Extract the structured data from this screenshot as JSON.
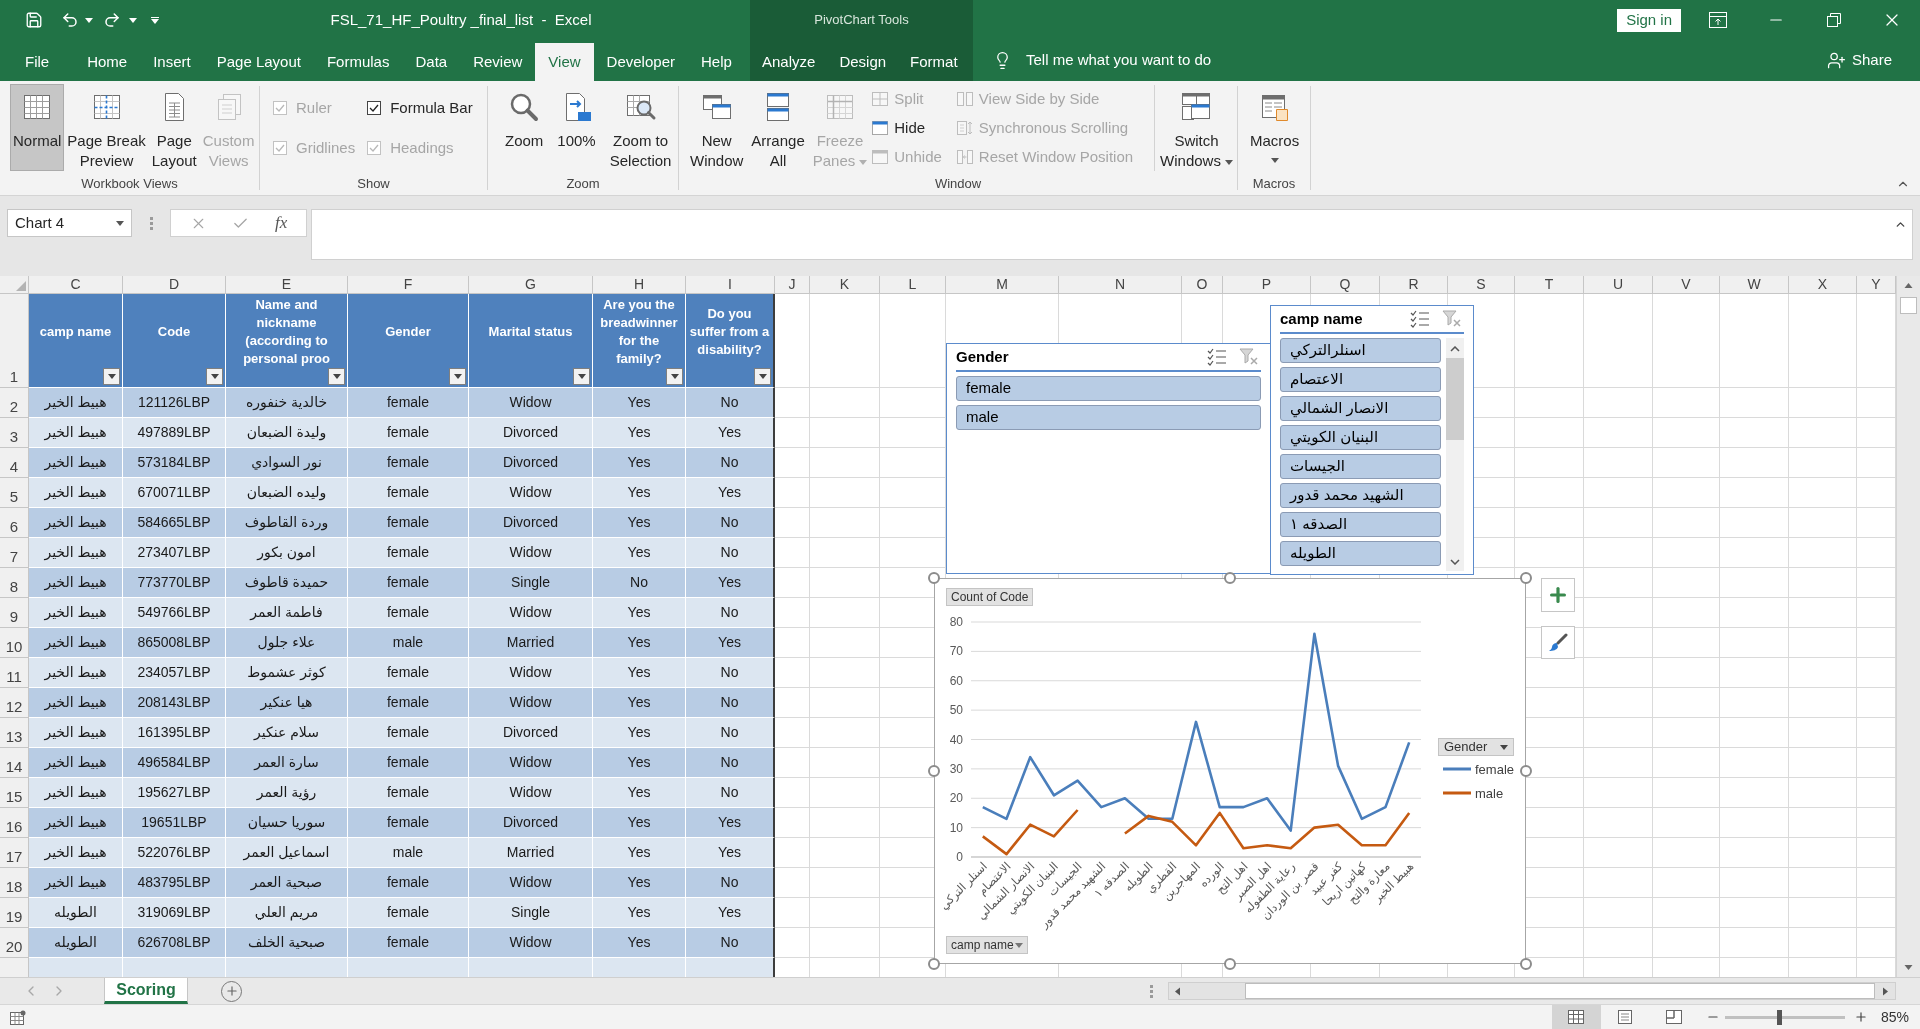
{
  "title_bar": {
    "title": "FSL_71_HF_Poultry _final_list  -  Excel",
    "context_label": "PivotChart Tools",
    "sign_in": "Sign in"
  },
  "ribbon_tabs": [
    {
      "label": "File",
      "selected": false
    },
    {
      "label": "Home",
      "selected": false
    },
    {
      "label": "Insert",
      "selected": false
    },
    {
      "label": "Page Layout",
      "selected": false
    },
    {
      "label": "Formulas",
      "selected": false
    },
    {
      "label": "Data",
      "selected": false
    },
    {
      "label": "Review",
      "selected": false
    },
    {
      "label": "View",
      "selected": true
    },
    {
      "label": "Developer",
      "selected": false
    },
    {
      "label": "Help",
      "selected": false
    }
  ],
  "context_tabs": [
    {
      "label": "Analyze",
      "selected": false
    },
    {
      "label": "Design",
      "selected": false
    },
    {
      "label": "Format",
      "selected": false
    }
  ],
  "tell_me": {
    "placeholder": "Tell me what you want to do"
  },
  "share": "Share",
  "ribbon_groups": [
    {
      "label": "Workbook Views",
      "columns": [
        {
          "kind": "large",
          "label": "Normal",
          "selected": true,
          "disabled": false
        },
        {
          "kind": "large",
          "label": "Page Break\nPreview",
          "selected": false,
          "disabled": false
        },
        {
          "kind": "large",
          "label": "Page\nLayout",
          "selected": false,
          "disabled": false
        },
        {
          "kind": "large",
          "label": "Custom\nViews",
          "selected": false,
          "disabled": true
        }
      ]
    },
    {
      "label": "Show",
      "columns": [
        {
          "kind": "stack",
          "items": [
            {
              "kind": "check",
              "label": "Ruler",
              "checked": true,
              "disabled": true
            },
            {
              "kind": "check",
              "label": "Gridlines",
              "checked": true,
              "disabled": true
            }
          ]
        },
        {
          "kind": "stack",
          "items": [
            {
              "kind": "check",
              "label": "Formula Bar",
              "checked": true,
              "disabled": false
            },
            {
              "kind": "check",
              "label": "Headings",
              "checked": true,
              "disabled": true
            }
          ]
        }
      ]
    },
    {
      "label": "Zoom",
      "columns": [
        {
          "kind": "large",
          "label": "Zoom",
          "disabled": false
        },
        {
          "kind": "large",
          "label": "100%",
          "disabled": false
        },
        {
          "kind": "large",
          "label": "Zoom to\nSelection",
          "disabled": false
        }
      ]
    },
    {
      "label": "Window",
      "columns": [
        {
          "kind": "large",
          "label": "New\nWindow",
          "disabled": false
        },
        {
          "kind": "large",
          "label": "Arrange\nAll",
          "disabled": false
        },
        {
          "kind": "large",
          "label": "Freeze\nPanes",
          "disabled": true,
          "dropdown": true
        },
        {
          "kind": "stack",
          "items": [
            {
              "kind": "small",
              "label": "Split",
              "disabled": true
            },
            {
              "kind": "small",
              "label": "Hide",
              "disabled": false
            },
            {
              "kind": "small",
              "label": "Unhide",
              "disabled": true
            }
          ]
        },
        {
          "kind": "stack",
          "items": [
            {
              "kind": "small",
              "label": "View Side by Side",
              "disabled": true
            },
            {
              "kind": "small",
              "label": "Synchronous Scrolling",
              "disabled": true
            },
            {
              "kind": "small",
              "label": "Reset Window Position",
              "disabled": true
            }
          ]
        },
        {
          "kind": "divider"
        },
        {
          "kind": "large",
          "label": "Switch\nWindows",
          "disabled": false,
          "dropdown": true
        }
      ]
    },
    {
      "label": "Macros",
      "columns": [
        {
          "kind": "large",
          "label": "Macros",
          "disabled": false,
          "dropdown": true
        }
      ]
    }
  ],
  "formula_bar": {
    "name_box": "Chart 4",
    "function_button": "fx"
  },
  "sheet": {
    "column_headers": [
      "C",
      "D",
      "E",
      "F",
      "G",
      "H",
      "I",
      "J",
      "K",
      "L",
      "M",
      "N",
      "O",
      "P",
      "Q",
      "R",
      "S",
      "T",
      "U",
      "V",
      "W",
      "X",
      "Y"
    ],
    "header_row": {
      "number": "1",
      "filter_buttons": true,
      "cells": [
        "camp name",
        "Code",
        "Name and nickname (according to personal proo",
        "Gender",
        "Marital status",
        "Are you the breadwinner for the family?",
        "Do you suffer from a disability?"
      ]
    },
    "rows": [
      {
        "number": "2",
        "cells": [
          "هبيط الخير",
          "121126LBP",
          "خالدية خنفوره",
          "female",
          "Widow",
          "Yes",
          "No"
        ]
      },
      {
        "number": "3",
        "cells": [
          "هبيط الخير",
          "497889LBP",
          "وليدة الضبعان",
          "female",
          "Divorced",
          "Yes",
          "Yes"
        ]
      },
      {
        "number": "4",
        "cells": [
          "هبيط الخير",
          "573184LBP",
          "نور السوادي",
          "female",
          "Divorced",
          "Yes",
          "No"
        ]
      },
      {
        "number": "5",
        "cells": [
          "هبيط الخير",
          "670071LBP",
          "وليده الضبعان",
          "female",
          "Widow",
          "Yes",
          "Yes"
        ]
      },
      {
        "number": "6",
        "cells": [
          "هبيط الخير",
          "584665LBP",
          "وردة القاطوف",
          "female",
          "Divorced",
          "Yes",
          "No"
        ]
      },
      {
        "number": "7",
        "cells": [
          "هبيط الخير",
          "273407LBP",
          "امون بكور",
          "female",
          "Widow",
          "Yes",
          "No"
        ]
      },
      {
        "number": "8",
        "cells": [
          "هبيط الخير",
          "773770LBP",
          "حميدة قاطوف",
          "female",
          "Single",
          "No",
          "Yes"
        ]
      },
      {
        "number": "9",
        "cells": [
          "هبيط الخير",
          "549766LBP",
          "فاطمة العمر",
          "female",
          "Widow",
          "Yes",
          "No"
        ]
      },
      {
        "number": "10",
        "cells": [
          "هبيط الخير",
          "865008LBP",
          "علاء جلول",
          "male",
          "Married",
          "Yes",
          "Yes"
        ]
      },
      {
        "number": "11",
        "cells": [
          "هبيط الخير",
          "234057LBP",
          "كوثر عشموط",
          "female",
          "Widow",
          "Yes",
          "No"
        ]
      },
      {
        "number": "12",
        "cells": [
          "هبيط الخير",
          "208143LBP",
          "هيا عنكير",
          "female",
          "Widow",
          "Yes",
          "No"
        ]
      },
      {
        "number": "13",
        "cells": [
          "هبيط الخير",
          "161395LBP",
          "سلام عنكير",
          "female",
          "Divorced",
          "Yes",
          "No"
        ]
      },
      {
        "number": "14",
        "cells": [
          "هبيط الخير",
          "496584LBP",
          "سارة العمر",
          "female",
          "Widow",
          "Yes",
          "No"
        ]
      },
      {
        "number": "15",
        "cells": [
          "هبيط الخير",
          "195627LBP",
          "رؤية العمر",
          "female",
          "Widow",
          "Yes",
          "No"
        ]
      },
      {
        "number": "16",
        "cells": [
          "هبيط الخير",
          "19651LBP",
          "سوريا حسيان",
          "female",
          "Divorced",
          "Yes",
          "Yes"
        ]
      },
      {
        "number": "17",
        "cells": [
          "هبيط الخير",
          "522076LBP",
          "اسماعيل العمر",
          "male",
          "Married",
          "Yes",
          "Yes"
        ]
      },
      {
        "number": "18",
        "cells": [
          "هبيط الخير",
          "483795LBP",
          "صبحية العمر",
          "female",
          "Widow",
          "Yes",
          "No"
        ]
      },
      {
        "number": "19",
        "cells": [
          "الطويله",
          "319069LBP",
          "مريم العلي",
          "female",
          "Single",
          "Yes",
          "Yes"
        ]
      },
      {
        "number": "20",
        "cells": [
          "الطويله",
          "626708LBP",
          "صبحية الخلف",
          "female",
          "Widow",
          "Yes",
          "No"
        ]
      }
    ]
  },
  "slicers": [
    {
      "title": "Gender",
      "scrollable": false,
      "items": [
        {
          "label": "female",
          "selected": true
        },
        {
          "label": "male",
          "selected": true
        }
      ]
    },
    {
      "title": "camp name",
      "scrollable": true,
      "items": [
        {
          "label": "اسنلرالتركي",
          "selected": true
        },
        {
          "label": "الاعتصام",
          "selected": true
        },
        {
          "label": "الانصار الشمالي",
          "selected": true
        },
        {
          "label": "البنيان الكويتي",
          "selected": true
        },
        {
          "label": "الجيسات",
          "selected": true
        },
        {
          "label": "الشهيد محمد قدور",
          "selected": true
        },
        {
          "label": "الصدقه ١",
          "selected": true
        },
        {
          "label": "الطويله",
          "selected": true
        }
      ]
    }
  ],
  "pivot_chart": {
    "selected": true,
    "value_field": "Count of Code",
    "axis_field": "camp name",
    "chart_data": [
      {
        "type": "line",
        "legend_title": "Gender",
        "legend": "right",
        "grid": true,
        "categories": [
          "اسنلر التركي",
          "الاعتصام",
          "الانصار الشمالي",
          "البنيان الكويتي",
          "الجيسات",
          "الشهيد محمد قدور",
          "الصدقه ١",
          "الطويله",
          "القطري",
          "المهاجرين",
          "الورده",
          "اهل التح",
          "اهل الصبر",
          "رعاية الطفوله",
          "قصر بن الوردان",
          "كفر عبيد",
          "كهاتين اريحا",
          "معارة والتح",
          "هبيط الخير"
        ],
        "series": [
          {
            "name": "female",
            "color": "#4a7ebb",
            "values": [
              17,
              13,
              34,
              21,
              26,
              17,
              20,
              13,
              13,
              46,
              17,
              17,
              20,
              9,
              76,
              31,
              13,
              17,
              39
            ]
          },
          {
            "name": "male",
            "color": "#c55a11",
            "values": [
              7,
              1,
              11,
              7,
              16,
              null,
              8,
              14,
              12,
              4,
              15,
              3,
              4,
              3,
              10,
              11,
              4,
              4,
              15
            ]
          }
        ],
        "ylim": [
          0,
          80
        ],
        "yticks": [
          0,
          10,
          20,
          30,
          40,
          50,
          60,
          70,
          80
        ]
      }
    ]
  },
  "sheet_tabs": [
    {
      "label": "Scoring",
      "selected": true
    }
  ],
  "status_bar": {
    "views": [
      {
        "kind": "normal",
        "selected": true
      },
      {
        "kind": "page_layout",
        "selected": false
      },
      {
        "kind": "page_break",
        "selected": false
      }
    ],
    "zoom": {
      "label": "85%",
      "level": 0.45
    }
  }
}
